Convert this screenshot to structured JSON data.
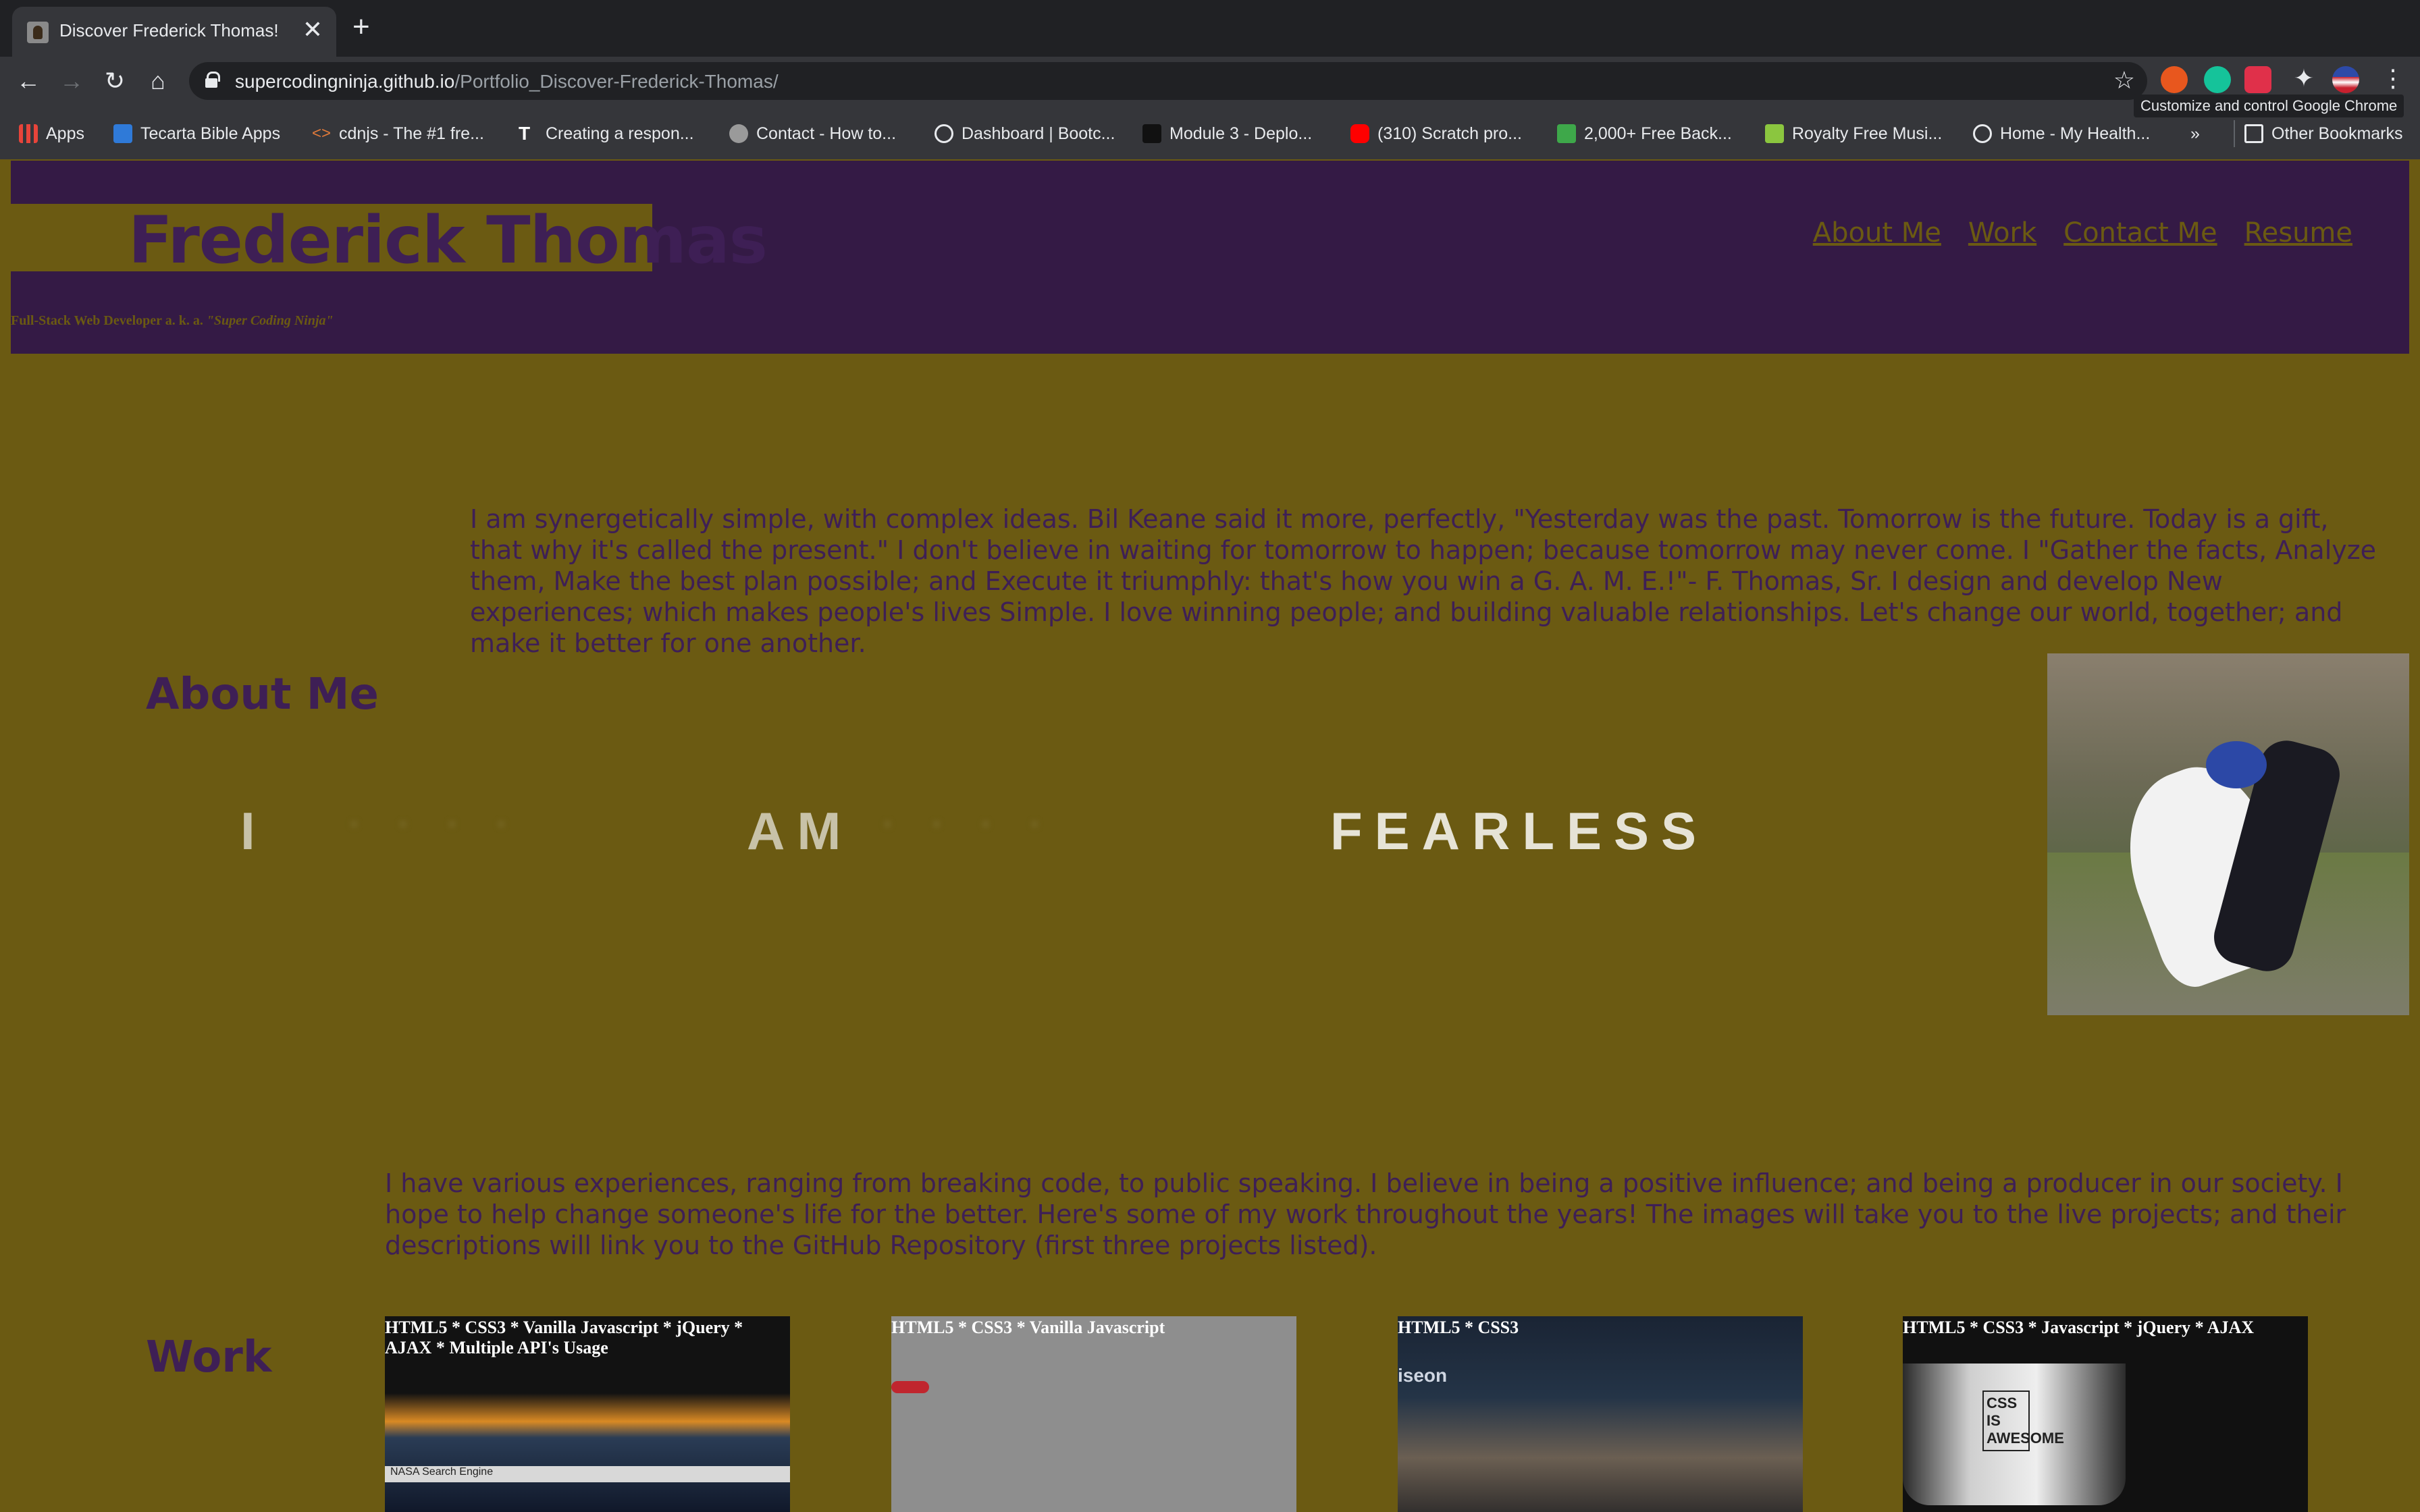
{
  "browser": {
    "tab_title": "Discover Frederick Thomas!",
    "tab_close": "✕",
    "new_tab": "+",
    "url_host": "supercodingninja.github.io",
    "url_path": "/Portfolio_Discover-Frederick-Thomas/",
    "tooltip": "Customize and control Google Chrome",
    "bookmarks": [
      {
        "label": "Apps",
        "icon": "apps-grid-icon",
        "color": "#e8443a"
      },
      {
        "label": "Tecarta Bible Apps",
        "icon": "tecarta-icon",
        "color": "#2f7ad8"
      },
      {
        "label": "cdnjs - The #1 fre...",
        "icon": "code-icon",
        "color": "#e07a3a"
      },
      {
        "label": "Creating a respon...",
        "icon": "t-letter-icon",
        "color": "#ffffff"
      },
      {
        "label": "Contact - How to...",
        "icon": "apple-icon",
        "color": "#bbbbbb"
      },
      {
        "label": "Dashboard | Bootc...",
        "icon": "globe-icon",
        "color": "#e8eaed"
      },
      {
        "label": "Module 3 - Deplo...",
        "icon": "book-icon",
        "color": "#222222"
      },
      {
        "label": "(310) Scratch pro...",
        "icon": "youtube-icon",
        "color": "#ff0000"
      },
      {
        "label": "2,000+ Free Back...",
        "icon": "px-icon",
        "color": "#3ea84a"
      },
      {
        "label": "Royalty Free Musi...",
        "icon": "b-letter-icon",
        "color": "#8bc63f"
      },
      {
        "label": "Home - My Health...",
        "icon": "globe-icon",
        "color": "#e8eaed"
      }
    ],
    "more_bookmarks": "»",
    "other_bookmarks": "Other Bookmarks"
  },
  "header": {
    "site_name": "Frederick Thomas",
    "tagline_prefix": "Full-Stack Web Developer  a. k. a. ",
    "tagline_alias": "\"Super Coding Ninja\"",
    "nav": [
      "About Me",
      "Work",
      "Contact Me",
      "Resume"
    ]
  },
  "bio": "I am synergetically simple, with complex ideas. Bil Keane said it more, perfectly, \"Yesterday was the past. Tomorrow is the future. Today is a gift, that why it's called the present.\" I don't believe in waiting for tomorrow to happen; because tomorrow may never come. I \"Gather the facts, Analyze them, Make the best plan possible; and Execute it triumphly: that's how you win a G. A. M. E.!\"- F. Thomas, Sr. I design and develop New experiences; which makes people's lives Simple. I love winning people; and building valuable relationships. Let's change our world, together; and make it better for one another.",
  "about": {
    "title": "About Me",
    "marquee": {
      "i": "I",
      "am": "AM",
      "fearless": "FEARLESS"
    }
  },
  "experience": "I have various experiences, ranging from breaking code, to public speaking. I believe in being a positive influence; and being a producer in our society. I hope to help change someone's life for the better. Here's some of my work throughout the years! The images will take you to the live projects; and their descriptions will link you to the GitHub Repository (first three projects listed).",
  "work": {
    "title": "Work",
    "projects": [
      {
        "label": "HTML5 * CSS3 * Vanilla Javascript * jQuery * AJAX * Multiple API's Usage",
        "screen_text": "NASA Search Engine"
      },
      {
        "label": "HTML5 * CSS3 * Vanilla Javascript",
        "screen_text": ""
      },
      {
        "label": "HTML5 * CSS3",
        "screen_text": "iseon"
      },
      {
        "label": "HTML5 * CSS3 * Javascript * jQuery * AJAX",
        "screen_text": "CSS IS AWESOME"
      }
    ]
  }
}
